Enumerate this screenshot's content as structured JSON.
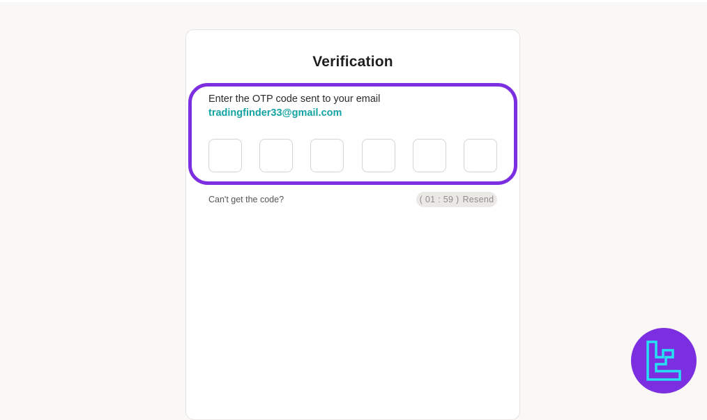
{
  "page": {
    "title": "Verification"
  },
  "otp": {
    "instruction": "Enter the OTP code sent to your email",
    "email": "tradingfinder33@gmail.com",
    "digits": [
      "",
      "",
      "",
      "",
      "",
      ""
    ]
  },
  "resend": {
    "question": "Can't get the code?",
    "timer": "( 01 : 59 )",
    "label": "Resend"
  },
  "colors": {
    "accent_purple": "#7b2fe0",
    "email_teal": "#14a3a3",
    "logo_cyan": "#25e0f0"
  },
  "icons": {
    "brand": "tradingfinder-logo-icon"
  }
}
